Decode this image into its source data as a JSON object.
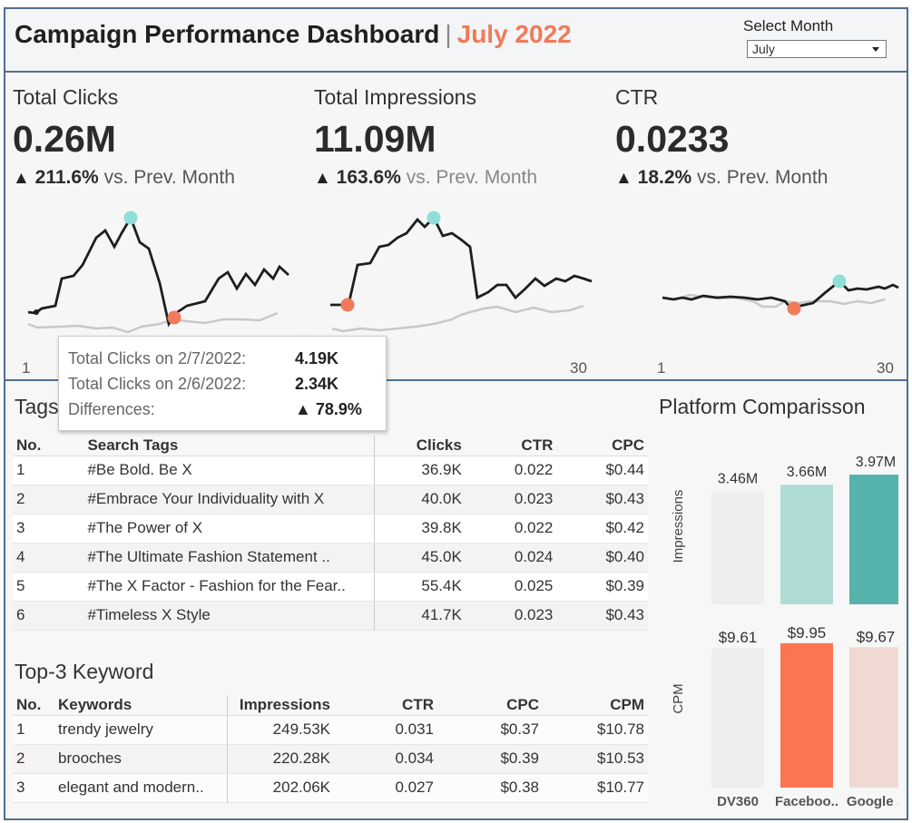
{
  "header": {
    "title": "Campaign Performance Dashboard",
    "separator": "|",
    "month": "July 2022",
    "select_label": "Select Month",
    "select_value": "July"
  },
  "kpis": [
    {
      "label": "Total Clicks",
      "value": "0.26M",
      "change": "211.6%",
      "suffix": "vs. Prev. Month",
      "axis_start": "1",
      "axis_end": ""
    },
    {
      "label": "Total Impressions",
      "value": "11.09M",
      "change": "163.6%",
      "suffix": "vs. Prev. Month",
      "axis_start": "",
      "axis_end": "30"
    },
    {
      "label": "CTR",
      "value": "0.0233",
      "change": "18.2%",
      "suffix": "vs. Prev. Month",
      "axis_start": "1",
      "axis_end": "30"
    }
  ],
  "tooltip": {
    "line1_label": "Total Clicks on  2/7/2022:",
    "line1_value": "4.19K",
    "line2_label": "Total Clicks on  2/6/2022:",
    "line2_value": "2.34K",
    "line3_label": "Differences:",
    "line3_value": "▲ 78.9%"
  },
  "tags": {
    "title": "Tags",
    "columns": [
      "No.",
      "Search Tags",
      "Clicks",
      "CTR",
      "CPC"
    ],
    "rows": [
      [
        "1",
        "#Be Bold. Be X",
        "36.9K",
        "0.022",
        "$0.44"
      ],
      [
        "2",
        "#Embrace Your Individuality with X",
        "40.0K",
        "0.023",
        "$0.43"
      ],
      [
        "3",
        "#The Power of X",
        "39.8K",
        "0.022",
        "$0.42"
      ],
      [
        "4",
        "#The Ultimate Fashion Statement ..",
        "45.0K",
        "0.024",
        "$0.40"
      ],
      [
        "5",
        "#The X Factor - Fashion for the Fear..",
        "55.4K",
        "0.025",
        "$0.39"
      ],
      [
        "6",
        "#Timeless X Style",
        "41.7K",
        "0.023",
        "$0.43"
      ]
    ]
  },
  "keywords": {
    "title": "Top-3 Keyword",
    "columns": [
      "No.",
      "Keywords",
      "Impressions",
      "CTR",
      "CPC",
      "CPM"
    ],
    "rows": [
      [
        "1",
        "trendy jewelry",
        "249.53K",
        "0.031",
        "$0.37",
        "$10.78"
      ],
      [
        "2",
        "brooches",
        "220.28K",
        "0.034",
        "$0.39",
        "$10.53"
      ],
      [
        "3",
        "elegant and modern..",
        "202.06K",
        "0.027",
        "$0.38",
        "$10.77"
      ]
    ]
  },
  "platform": {
    "title": "Platform Comparisson",
    "impressions_label": "Impressions",
    "cpm_label": "CPM",
    "categories": [
      "DV360",
      "Faceboo..",
      "Google .."
    ],
    "impressions": [
      3.46,
      3.66,
      3.97
    ],
    "impressions_labels": [
      "3.46M",
      "3.66M",
      "3.97M"
    ],
    "cpm": [
      9.61,
      9.95,
      9.67
    ],
    "cpm_labels": [
      "$9.61",
      "$9.95",
      "$9.67"
    ],
    "impressions_colors": [
      "#eeeeee",
      "#afdcd6",
      "#55b3ab"
    ],
    "cpm_colors": [
      "#eeeeee",
      "#fb7650",
      "#f1d9d3"
    ]
  },
  "colors": {
    "accent_orange": "#f07a5a",
    "teal_marker": "#8fded8",
    "line_current": "#1e1e1e",
    "line_previous": "#c8c8c8",
    "border": "#4f6f8f"
  }
}
